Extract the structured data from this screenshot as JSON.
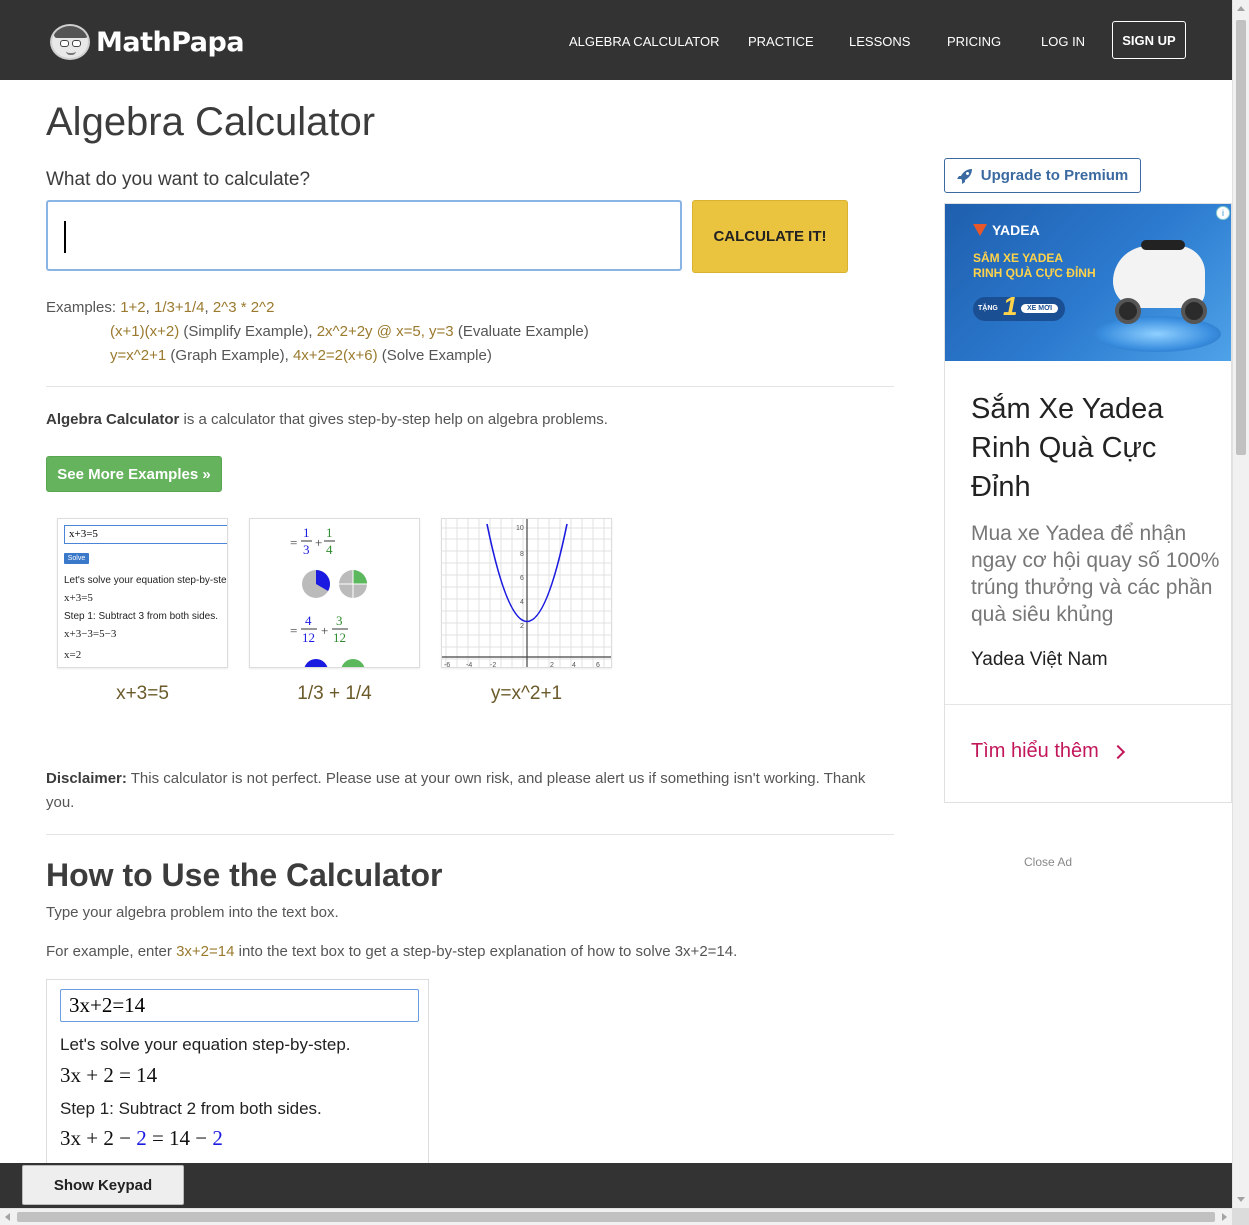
{
  "brand": {
    "name": "MathPapa"
  },
  "nav": {
    "items": [
      "ALGEBRA CALCULATOR",
      "PRACTICE",
      "LESSONS",
      "PRICING",
      "LOG IN"
    ],
    "signup": "SIGN UP"
  },
  "main": {
    "title": "Algebra Calculator",
    "prompt": "What do you want to calculate?",
    "input_value": "",
    "calculate_button": "CALCULATE IT!",
    "examples_label": "Examples:",
    "examples": {
      "line1": [
        {
          "text": "1+2",
          "sep": ", "
        },
        {
          "text": "1/3+1/4",
          "sep": ", "
        },
        {
          "text": "2^3 * 2^2",
          "sep": ""
        }
      ],
      "line2_a": "(x+1)(x+2)",
      "line2_a_note": " (Simplify Example), ",
      "line2_b": "2x^2+2y @ x=5, y=3",
      "line2_b_note": " (Evaluate Example)",
      "line3_a": "y=x^2+1",
      "line3_a_note": " (Graph Example), ",
      "line3_b": "4x+2=2(x+6)",
      "line3_b_note": " (Solve Example)"
    },
    "intro_bold": "Algebra Calculator",
    "intro_rest": " is a calculator that gives step-by-step help on algebra problems.",
    "see_more_button": "See More Examples »",
    "thumbnails": [
      {
        "caption": "x+3=5",
        "input": "x+3=5",
        "solve_button": "Solve",
        "lines": [
          "Let's solve your equation step-by-step.",
          "x+3=5",
          "Step 1: Subtract 3 from both sides.",
          "x+3−3=5−3",
          "x=2"
        ]
      },
      {
        "caption": "1/3 + 1/4"
      },
      {
        "caption": "y=x^2+1"
      }
    ],
    "disclaimer_bold": "Disclaimer:",
    "disclaimer_rest": " This calculator is not perfect. Please use at your own risk, and please alert us if something isn't working. Thank you.",
    "howto_title": "How to Use the Calculator",
    "howto_p1": "Type your algebra problem into the text box.",
    "howto_p2_a": "For example, enter ",
    "howto_p2_link": "3x+2=14",
    "howto_p2_b": " into the text box to get a step-by-step explanation of how to solve 3x+2=14.",
    "demo": {
      "input": "3x+2=14",
      "line1": "Let's solve your equation step-by-step.",
      "math1": "3x + 2 = 14",
      "line2": "Step 1: Subtract 2 from both sides.",
      "math2_a": "3x + 2 − ",
      "math2_b": "2",
      "math2_c": " = 14 − ",
      "math2_d": "2"
    }
  },
  "sidebar": {
    "premium_button": "Upgrade to Premium",
    "ad": {
      "banner_brand": "YADEA",
      "banner_line1": "SẮM XE YADEA",
      "banner_line2": "RINH QUÀ CỰC ĐỈNH",
      "banner_badge_left": "TẶNG",
      "banner_badge_num": "1",
      "banner_badge_right": "XE MỚI",
      "title": "Sắm Xe Yadea Rinh Quà Cực Đỉnh",
      "description": "Mua xe Yadea để nhận ngay cơ hội quay số 100% trúng thưởng và các phần quà siêu khủng",
      "advertiser": "Yadea Việt Nam",
      "cta": "Tìm hiểu thêm",
      "info": "i"
    },
    "close_ad": "Close Ad"
  },
  "bottom": {
    "keypad_button": "Show Keypad"
  },
  "colors": {
    "nav_bg": "#333333",
    "calc_button": "#ebc43f",
    "see_more": "#66b35e",
    "example_link": "#9a7a2e",
    "premium": "#3b6aa0",
    "ad_cta": "#c2185b"
  }
}
